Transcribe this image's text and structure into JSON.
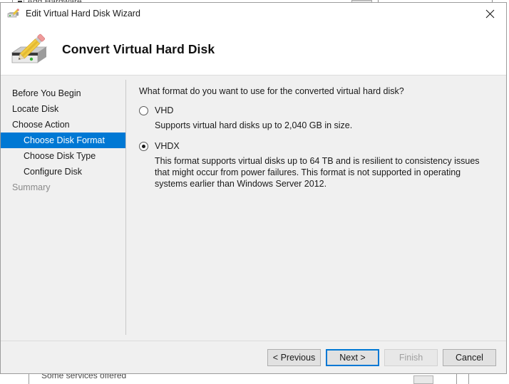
{
  "background_window": {
    "top_row_label": "Add Hardware",
    "bottom_row_label": "Some services offered"
  },
  "titlebar": {
    "title": "Edit Virtual Hard Disk Wizard",
    "icon": "edit-virtual-hard-disk-icon",
    "close_label": "×"
  },
  "header": {
    "title": "Convert Virtual Hard Disk",
    "icon": "virtual-hard-disk-pencil-icon"
  },
  "sidebar": {
    "items": [
      {
        "label": "Before You Begin",
        "indent": false,
        "selected": false,
        "disabled": false
      },
      {
        "label": "Locate Disk",
        "indent": false,
        "selected": false,
        "disabled": false
      },
      {
        "label": "Choose Action",
        "indent": false,
        "selected": false,
        "disabled": false
      },
      {
        "label": "Choose Disk Format",
        "indent": true,
        "selected": true,
        "disabled": false
      },
      {
        "label": "Choose Disk Type",
        "indent": true,
        "selected": false,
        "disabled": false
      },
      {
        "label": "Configure Disk",
        "indent": true,
        "selected": false,
        "disabled": false
      },
      {
        "label": "Summary",
        "indent": false,
        "selected": false,
        "disabled": true
      }
    ]
  },
  "content": {
    "question": "What format do you want to use for the converted virtual hard disk?",
    "options": [
      {
        "label": "VHD",
        "selected": false,
        "description": "Supports virtual hard disks up to 2,040 GB in size."
      },
      {
        "label": "VHDX",
        "selected": true,
        "description": "This format supports virtual disks up to 64 TB and is resilient to consistency issues that might occur from power failures. This format is not supported in operating systems earlier than Windows Server 2012."
      }
    ]
  },
  "footer": {
    "previous_label": "< Previous",
    "next_label": "Next >",
    "finish_label": "Finish",
    "cancel_label": "Cancel"
  },
  "colors": {
    "accent": "#0078d4",
    "dialog_bg": "#f0f0f0",
    "header_bg": "#ffffff",
    "text": "#1a1a1a",
    "disabled_text": "#8a8a8a"
  }
}
